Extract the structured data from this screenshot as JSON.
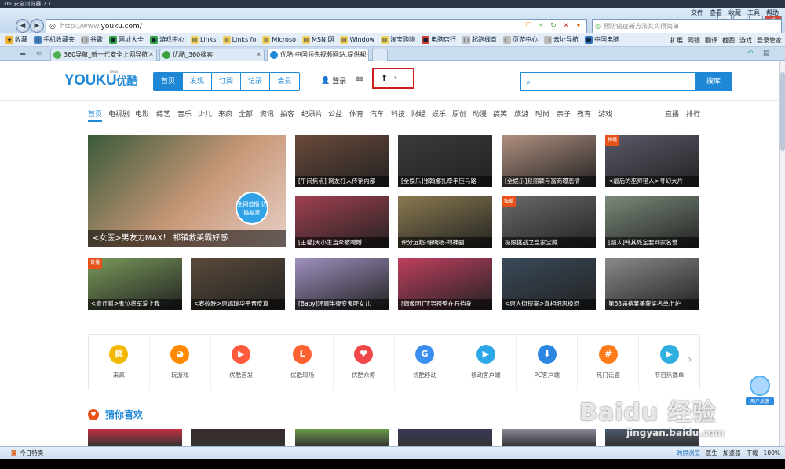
{
  "window": {
    "title": "360安全浏览器 7.1"
  },
  "menu": [
    "文件",
    "查看",
    "收藏",
    "工具",
    "帮助"
  ],
  "window_buttons": [
    "▬",
    "▭",
    "▭",
    "✕"
  ],
  "address": {
    "proto": "http://www.",
    "host": "youku.com/"
  },
  "nav": {
    "back": "◀",
    "forward": "▶"
  },
  "search": {
    "placeholder": "预防癌症新方法其实很简单"
  },
  "favorites": [
    {
      "label": "收藏",
      "color": "#f0b030",
      "glyph": "★"
    },
    {
      "label": "手机收藏夹",
      "color": "#4a80c0",
      "glyph": "▯"
    },
    {
      "label": "谷歌",
      "color": "#bbbbbb",
      "glyph": "□"
    },
    {
      "label": "网址大全",
      "color": "#30a040",
      "glyph": "●"
    },
    {
      "label": "游戏中心",
      "color": "#30a040",
      "glyph": "●"
    },
    {
      "label": "Links",
      "color": "#f0d060",
      "glyph": "▤"
    },
    {
      "label": "Links fo",
      "color": "#f0d060",
      "glyph": "▤"
    },
    {
      "label": "Microso",
      "color": "#f0d060",
      "glyph": "▤"
    },
    {
      "label": "MSN 网",
      "color": "#f0d060",
      "glyph": "▤"
    },
    {
      "label": "Window",
      "color": "#f0d060",
      "glyph": "▤"
    },
    {
      "label": "淘宝购物",
      "color": "#f0d060",
      "glyph": "▤"
    },
    {
      "label": "电脑店行",
      "color": "#d04030",
      "glyph": "■"
    },
    {
      "label": "起跑线育",
      "color": "#bbbbbb",
      "glyph": "□"
    },
    {
      "label": "页游中心",
      "color": "#bbbbbb",
      "glyph": "□"
    },
    {
      "label": "云址导航",
      "color": "#bbbbbb",
      "glyph": "□"
    },
    {
      "label": "中国电脑",
      "color": "#3070c0",
      "glyph": "■"
    }
  ],
  "fav_right": [
    "扩展",
    "网银",
    "翻译",
    "截图",
    "游戏",
    "登录管家"
  ],
  "tabs": [
    {
      "label": "360导航_新一代安全上网导航",
      "color": "#4caf50"
    },
    {
      "label": "优酷_360搜索",
      "color": "#3aa03a"
    },
    {
      "label": "优酷-中国领先视频网站,提供视",
      "color": "#1f88d6"
    }
  ],
  "youku": {
    "logo_en": "YOUKU",
    "logo_cn": "优酷",
    "beta": "beta",
    "nav": [
      "首页",
      "发现",
      "订阅",
      "记录",
      "会员"
    ],
    "login": "登录",
    "search_button": "搜库",
    "channels_left": [
      "首页",
      "电视剧",
      "电影",
      "综艺",
      "音乐",
      "少儿",
      "来疯",
      "全部",
      "资讯",
      "拍客",
      "纪录片",
      "公益",
      "体育",
      "汽车",
      "科技",
      "财经",
      "娱乐",
      "原创",
      "动漫",
      "搞笑",
      "旅游",
      "时尚",
      "亲子",
      "教育",
      "游戏"
    ],
    "channels_right": [
      "直播",
      "排行"
    ]
  },
  "tiles": {
    "big": {
      "caption": "<女医>男友力MAX！ 祁镇救美霸好感",
      "stamp": "全网首播 优酷独家"
    },
    "small": [
      {
        "caption": "[午间焦点] 网友打人传销内部",
        "badge": ""
      },
      {
        "caption": "[全娱乐]张翰娜扎牵手压马路",
        "badge": ""
      },
      {
        "caption": "[全娱乐]赵丽颖与富商曝恋情",
        "badge": ""
      },
      {
        "caption": "<最后的巫师猎人>寻幻大片",
        "badge": "独播"
      },
      {
        "caption": "[王馨]天小生当众被聘婚",
        "badge": ""
      },
      {
        "caption": "评分远超-珊瑚杨-的神剧",
        "badge": ""
      },
      {
        "caption": "极限挑战之皇家宝藏",
        "badge": "独播"
      },
      {
        "caption": "[超人]韩其处定要到家名誉",
        "badge": ""
      },
      {
        "caption": "<青丘狐>鬼泣将军爱上我",
        "badge": "首播"
      },
      {
        "caption": "<春欲晚>唐嫣瑞华乎晋皮真",
        "badge": ""
      },
      {
        "caption": "[Baby]环顾半夜变鬼吓女儿",
        "badge": ""
      },
      {
        "caption": "[偶像团]TF男孩壁在石挡身",
        "badge": ""
      },
      {
        "caption": "<唐人街探案>真相细思极恐",
        "badge": ""
      },
      {
        "caption": "第68届格莱美获奖名单出炉",
        "badge": ""
      }
    ]
  },
  "icon_row": [
    {
      "label": "来疯",
      "color": "#f3b700",
      "glyph": "疯"
    },
    {
      "label": "玩游戏",
      "color": "#ff8a00",
      "glyph": "◕"
    },
    {
      "label": "优酷首发",
      "color": "#ff5a3c",
      "glyph": "▶"
    },
    {
      "label": "优酷现场",
      "color": "#ff6030",
      "glyph": "L"
    },
    {
      "label": "优酷众筹",
      "color": "#f04848",
      "glyph": "♥"
    },
    {
      "label": "优酷移动",
      "color": "#3a8ef0",
      "glyph": "G"
    },
    {
      "label": "移动客户端",
      "color": "#2ea7e8",
      "glyph": "▶"
    },
    {
      "label": "PC客户端",
      "color": "#2a86e0",
      "glyph": "⬇"
    },
    {
      "label": "热门话题",
      "color": "#ff7a1a",
      "glyph": "#"
    },
    {
      "label": "节目热播单",
      "color": "#2fb0e0",
      "glyph": "▶"
    }
  ],
  "guess_title": "猜你喜欢",
  "feedback": "用户反馈",
  "status": {
    "left": "今日特卖",
    "right": [
      "跨屏浏览",
      "医生",
      "加速器",
      "下载",
      "100%"
    ]
  },
  "watermark": {
    "main": "Baidu 经验",
    "sub": "jingyan.baidu.com"
  },
  "palette": {
    "youku_blue": "#1f88d6",
    "youku_red": "#e0301e",
    "highlight": "#d01e1e"
  }
}
